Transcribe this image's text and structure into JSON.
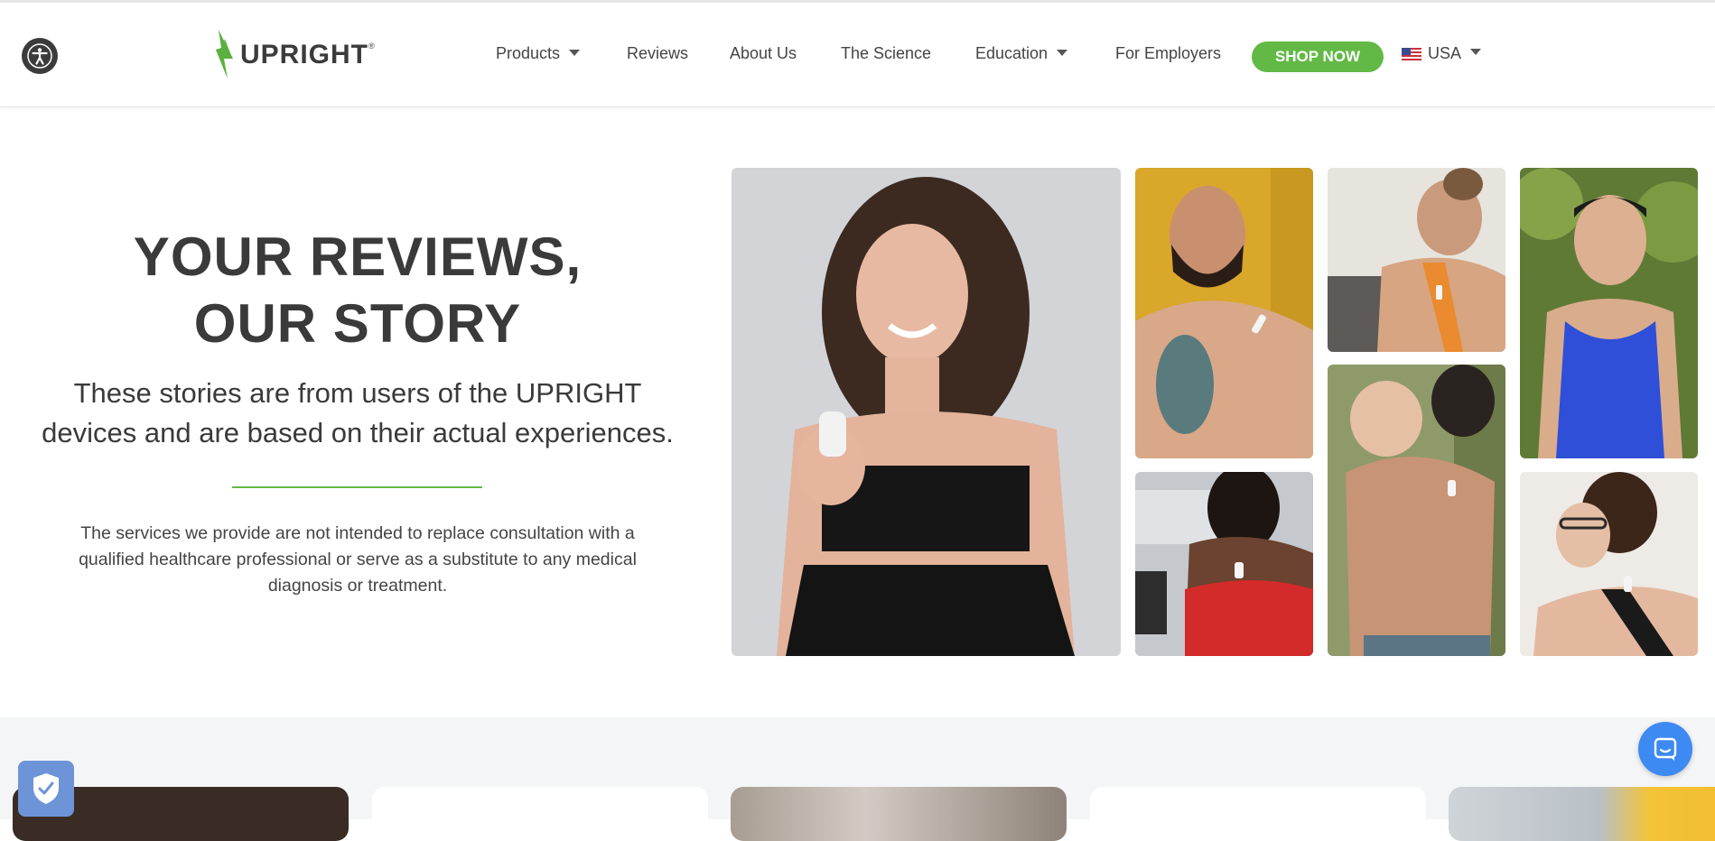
{
  "header": {
    "brand": "UPRIGHT",
    "brand_mark": "®",
    "accessibility_icon": "accessibility-icon",
    "nav": [
      {
        "label": "Products",
        "dropdown": true
      },
      {
        "label": "Reviews",
        "dropdown": false
      },
      {
        "label": "About Us",
        "dropdown": false
      },
      {
        "label": "The Science",
        "dropdown": false
      },
      {
        "label": "Education",
        "dropdown": true
      },
      {
        "label": "For Employers",
        "dropdown": false
      }
    ],
    "cta_label": "SHOP NOW",
    "country_label": "USA",
    "country_flag_icon": "us-flag-icon"
  },
  "hero": {
    "title_line1": "YOUR REVIEWS,",
    "title_line2": "OUR STORY",
    "subtitle_line1": "These stories are from users of the UPRIGHT",
    "subtitle_line2": "devices and are based on their actual experiences.",
    "disclaimer_line1": "The services we provide are not intended to replace consultation with a",
    "disclaimer_line2": "qualified healthcare professional or serve as a substitute to any medical",
    "disclaimer_line3": "diagnosis or treatment."
  },
  "gallery": {
    "photos": [
      "woman-holding-device",
      "bearded-man-tattoo",
      "woman-orange-top",
      "man-blue-tank",
      "woman-red-top",
      "man-holding-baby",
      "woman-glasses"
    ]
  },
  "widgets": {
    "privacy_icon": "shield-check-icon",
    "chat_icon": "chat-icon"
  },
  "colors": {
    "brand_green": "#62b946",
    "text_dark": "#3a3a3a",
    "chat_blue": "#3d8af2",
    "privacy_blue": "#6d94d6"
  }
}
